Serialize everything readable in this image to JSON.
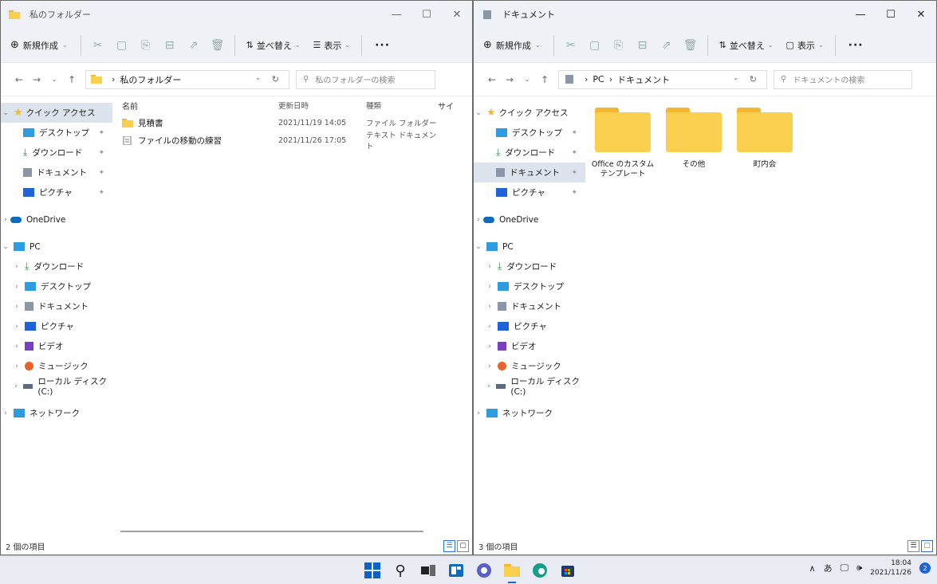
{
  "left": {
    "title": "私のフォルダー",
    "toolbar": {
      "new": "新規作成",
      "sort": "並べ替え",
      "view": "表示",
      "more": "···"
    },
    "address": {
      "path": "私のフォルダー",
      "search_placeholder": "私のフォルダーの検索"
    },
    "columns": {
      "name": "名前",
      "date": "更新日時",
      "type": "種類",
      "size": "サイ"
    },
    "files": [
      {
        "name": "見積書",
        "date": "2021/11/19 14:05",
        "type": "ファイル フォルダー",
        "icon": "folder-icon"
      },
      {
        "name": "ファイルの移動の練習",
        "date": "2021/11/26 17:05",
        "type": "テキスト ドキュメント",
        "icon": "text-file-icon"
      }
    ],
    "status": "2 個の項目"
  },
  "right": {
    "title": "ドキュメント",
    "toolbar": {
      "new": "新規作成",
      "sort": "並べ替え",
      "view": "表示",
      "more": "···"
    },
    "address": {
      "pc": "PC",
      "path": "ドキュメント",
      "search_placeholder": "ドキュメントの検索"
    },
    "folders": [
      {
        "name": "Office のカスタム テンプレート"
      },
      {
        "name": "その他"
      },
      {
        "name": "町内会"
      }
    ],
    "status": "3 個の項目"
  },
  "nav": {
    "quick_access": "クイック アクセス",
    "desktop": "デスクトップ",
    "downloads": "ダウンロード",
    "documents": "ドキュメント",
    "pictures": "ピクチャ",
    "onedrive": "OneDrive",
    "pc": "PC",
    "videos": "ビデオ",
    "music": "ミュージック",
    "local_disk": "ローカル ディスク (C:)",
    "network": "ネットワーク"
  },
  "tray": {
    "ime": "あ",
    "time": "18:04",
    "date": "2021/11/26",
    "notifications": "2"
  },
  "colors": {
    "folder": "#fbcf4e",
    "accent": "#2a6ed6",
    "selected": "#dde3ec"
  }
}
